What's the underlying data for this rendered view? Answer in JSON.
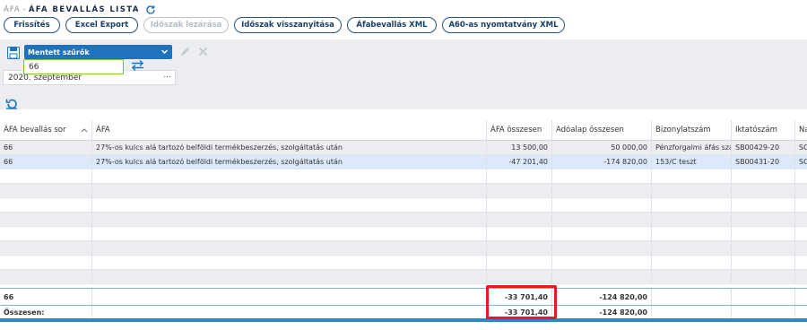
{
  "breadcrumb": {
    "parent": "ÁFA",
    "separator": "-",
    "current": "ÁFA BEVALLÁS LISTA"
  },
  "toolbar": {
    "buttons": [
      {
        "label": "Frissítés",
        "enabled": true
      },
      {
        "label": "Excel Export",
        "enabled": true
      },
      {
        "label": "Időszak lezárása",
        "enabled": false
      },
      {
        "label": "Időszak visszanyitása",
        "enabled": true
      },
      {
        "label": "Áfabevallás XML",
        "enabled": true
      },
      {
        "label": "A60-as nyomtatvány XML",
        "enabled": true
      }
    ]
  },
  "filters": {
    "saved_filters_label": "Mentett szűrők",
    "period_value": "2020. szeptember",
    "period_more": "...",
    "search_value": "66"
  },
  "grid": {
    "columns": [
      "ÁFA bevallás sor",
      "ÁFA",
      "ÁFA összesen",
      "Adóalap összesen",
      "Bizonylatszám",
      "Iktatószám",
      "Na"
    ],
    "rows": [
      [
        "66",
        "27%-os kulcs alá tartozó belföldi termékbeszerzés, szolgáltatás után",
        "13 500,00",
        "50 000,00",
        "Pénzforgalmi áfás szá",
        "SB00429-20",
        "SC"
      ],
      [
        "66",
        "27%-os kulcs alá tartozó belföldi termékbeszerzés, szolgáltatás után",
        "-47 201,40",
        "-174 820,00",
        "153/C teszt",
        "SB00431-20",
        "SC"
      ]
    ],
    "empty_rows": 8,
    "group_total": {
      "label": "66",
      "afa": "-33 701,40",
      "base": "-124 820,00"
    },
    "grand_total": {
      "label": "Összesen:",
      "afa": "-33 701,40",
      "base": "-124 820,00"
    }
  },
  "colors": {
    "accent": "#1e73bc",
    "highlight": "#e8191f",
    "selected_row": "#dce9fb"
  }
}
